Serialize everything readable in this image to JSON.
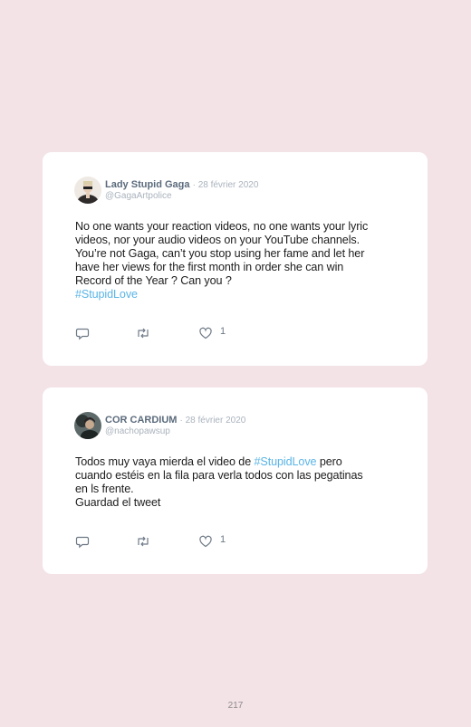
{
  "tweets": [
    {
      "display_name": "Lady Stupid Gaga",
      "date": "28 février 2020",
      "handle": "@GagaArtpolice",
      "lines": [
        "No one wants your reaction videos, no one wants your lyric",
        "videos, nor your audio videos on your YouTube channels.",
        "You’re not Gaga, can’t you stop using her fame and let her",
        "have her views for the first month in order she can win",
        "Record of the Year ? Can you ?"
      ],
      "hashtag_line": "#StupidLove",
      "like_count": "1"
    },
    {
      "display_name": "COR CARDIUM",
      "date": "28 février 2020",
      "handle": "@nachopawsup",
      "line1_before": "Todos muy vaya mierda el video de ",
      "line1_hashtag": "#StupidLove",
      "line1_after": " pero",
      "lines": [
        "cuando estéis en la fila para verla todos con las pegatinas",
        "en ls frente.",
        "Guardad el tweet"
      ],
      "like_count": "1"
    }
  ],
  "page_number": "217",
  "icons": {
    "reply": "reply-icon",
    "retweet": "retweet-icon",
    "like": "heart-icon"
  },
  "colors": {
    "background": "#f3e3e7",
    "card": "#ffffff",
    "hashtag": "#5ab4e6",
    "name": "#5b6b7c",
    "muted": "#aab3bd"
  }
}
